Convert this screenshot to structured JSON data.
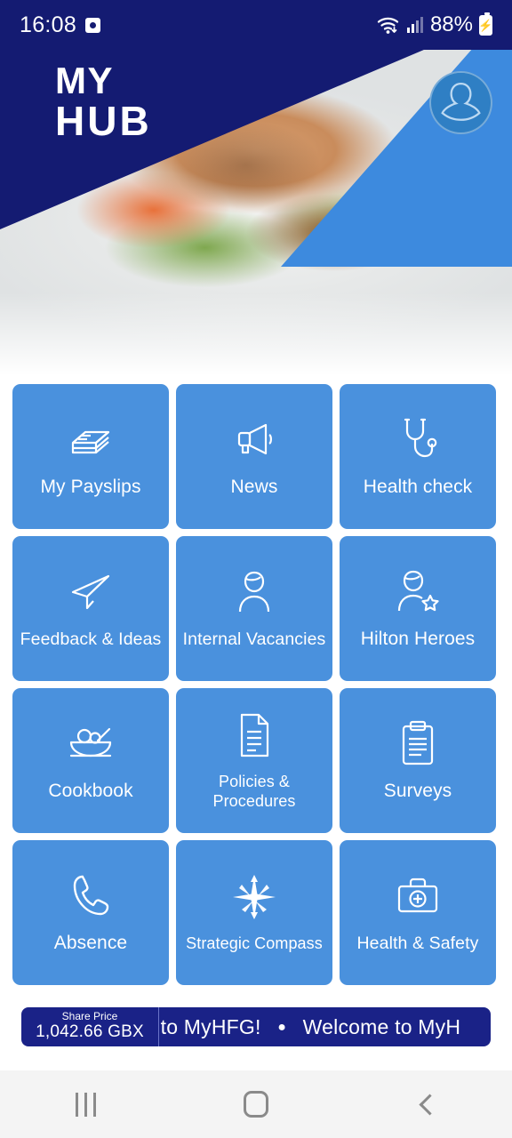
{
  "status_bar": {
    "time": "16:08",
    "alarm_icon": "alarm-icon",
    "wifi_icon": "wifi-icon",
    "signal_icon": "cellular-signal-icon",
    "battery_percent": "88%",
    "battery_icon": "battery-charging-icon"
  },
  "header": {
    "logo_line1": "MY",
    "logo_line2": "HUB",
    "avatar_icon": "user-avatar-icon",
    "hero_image_alt": "grilled-salmon-salad-photo",
    "navy": "#141b72",
    "accent_blue": "#3d8ade"
  },
  "tiles": [
    {
      "label": "My Payslips",
      "icon": "banknotes-icon",
      "style": ""
    },
    {
      "label": "News",
      "icon": "megaphone-icon",
      "style": ""
    },
    {
      "label": "Health check",
      "icon": "stethoscope-icon",
      "style": ""
    },
    {
      "label": "Feedback & Ideas",
      "icon": "paper-plane-icon",
      "style": "tight"
    },
    {
      "label": "Internal Vacancies",
      "icon": "person-icon",
      "style": "tight"
    },
    {
      "label": "Hilton Heroes",
      "icon": "person-star-icon",
      "style": ""
    },
    {
      "label": "Cookbook",
      "icon": "food-bowl-icon",
      "style": ""
    },
    {
      "label": "Policies &\nProcedures",
      "icon": "document-icon",
      "style": "small"
    },
    {
      "label": "Surveys",
      "icon": "clipboard-icon",
      "style": ""
    },
    {
      "label": "Absence",
      "icon": "phone-icon",
      "style": ""
    },
    {
      "label": "Strategic Compass",
      "icon": "compass-rose-icon",
      "style": "small"
    },
    {
      "label": "Health & Safety",
      "icon": "first-aid-kit-icon",
      "style": "tight"
    }
  ],
  "tile_color": "#4a91dd",
  "ticker": {
    "share_price_label": "Share Price",
    "share_price_value": "1,042.66 GBX",
    "marquee_text_a": "come to MyHFG!",
    "marquee_separator": "●",
    "marquee_text_b": "Welcome to MyH",
    "background": "#1a2287"
  },
  "nav_bar": {
    "recents_icon": "recents-icon",
    "home_icon": "home-icon",
    "back_icon": "back-icon"
  }
}
